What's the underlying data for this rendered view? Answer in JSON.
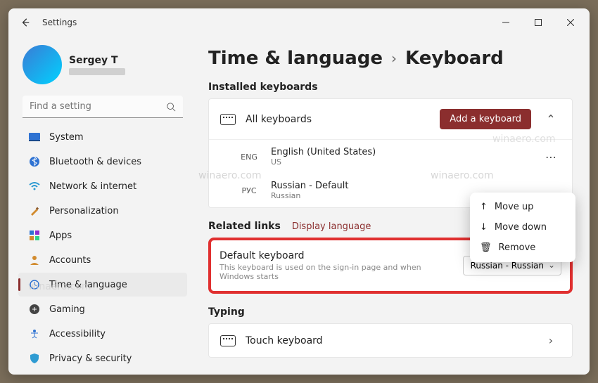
{
  "titlebar": {
    "title": "Settings"
  },
  "profile": {
    "name": "Sergey T"
  },
  "search": {
    "placeholder": "Find a setting"
  },
  "sidebar": {
    "items": [
      {
        "label": "System"
      },
      {
        "label": "Bluetooth & devices"
      },
      {
        "label": "Network & internet"
      },
      {
        "label": "Personalization"
      },
      {
        "label": "Apps"
      },
      {
        "label": "Accounts"
      },
      {
        "label": "Time & language"
      },
      {
        "label": "Gaming"
      },
      {
        "label": "Accessibility"
      },
      {
        "label": "Privacy & security"
      }
    ]
  },
  "breadcrumb": {
    "parent": "Time & language",
    "current": "Keyboard"
  },
  "installed": {
    "section_title": "Installed keyboards",
    "all_label": "All keyboards",
    "add_label": "Add a keyboard",
    "items": [
      {
        "tag": "ENG",
        "name": "English (United States)",
        "sub": "US"
      },
      {
        "tag": "РУС",
        "name": "Russian  - Default",
        "sub": "Russian"
      }
    ]
  },
  "related": {
    "label": "Related links",
    "link": "Display language"
  },
  "default_keyboard": {
    "title": "Default keyboard",
    "desc": "This keyboard is used on the sign-in page and when Windows starts",
    "selected": "Russian - Russian"
  },
  "typing": {
    "section_title": "Typing",
    "touch_label": "Touch keyboard"
  },
  "ctx": {
    "move_up": "Move up",
    "move_down": "Move down",
    "remove": "Remove"
  },
  "watermark": "winaero.com"
}
